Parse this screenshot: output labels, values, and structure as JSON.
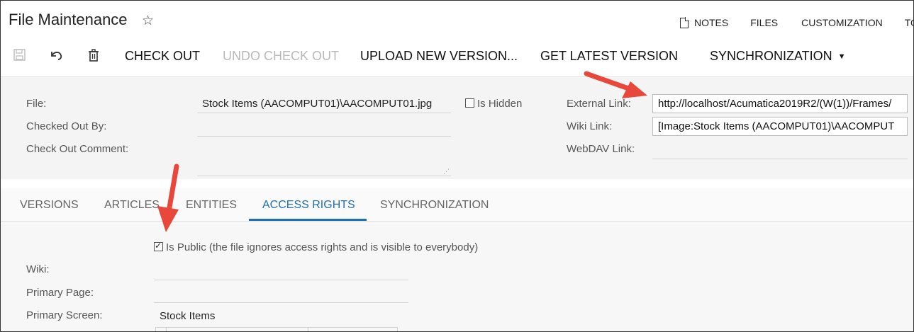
{
  "header": {
    "title": "File Maintenance",
    "nav": [
      {
        "label": "NOTES"
      },
      {
        "label": "FILES"
      },
      {
        "label": "CUSTOMIZATION"
      },
      {
        "label": "TO"
      }
    ]
  },
  "toolbar": {
    "save_icon": "save-icon",
    "undo_icon": "undo-icon",
    "delete_icon": "trash-icon",
    "check_out": "CHECK OUT",
    "undo_check_out": "UNDO CHECK OUT",
    "upload_new_version": "UPLOAD NEW VERSION...",
    "get_latest_version": "GET LATEST VERSION",
    "synchronization": "SYNCHRONIZATION"
  },
  "form": {
    "file_label": "File:",
    "file_value": "Stock Items (AACOMPUT01)\\AACOMPUT01.jpg",
    "is_hidden_label": "Is Hidden",
    "is_hidden_checked": false,
    "checked_out_by_label": "Checked Out By:",
    "checked_out_by_value": "",
    "check_out_comment_label": "Check Out Comment:",
    "check_out_comment_value": "",
    "external_link_label": "External Link:",
    "external_link_value": "http://localhost/Acumatica2019R2/(W(1))/Frames/",
    "wiki_link_label": "Wiki Link:",
    "wiki_link_value": "[Image:Stock Items (AACOMPUT01)\\AACOMPUT",
    "webdav_link_label": "WebDAV Link:",
    "webdav_link_value": ""
  },
  "tabs": [
    {
      "label": "VERSIONS",
      "active": false
    },
    {
      "label": "ARTICLES",
      "active": false
    },
    {
      "label": "ENTITIES",
      "active": false
    },
    {
      "label": "ACCESS RIGHTS",
      "active": true
    },
    {
      "label": "SYNCHRONIZATION",
      "active": false
    }
  ],
  "access_rights": {
    "is_public_label": "Is Public (the file ignores access rights and is visible to everybody)",
    "is_public_checked": true,
    "wiki_label": "Wiki:",
    "wiki_value": "",
    "primary_page_label": "Primary Page:",
    "primary_page_value": "",
    "primary_screen_label": "Primary Screen:",
    "primary_screen_value": "Stock Items"
  },
  "colors": {
    "accent": "#1f6fb2",
    "annotation_arrow": "#e8473c",
    "disabled_text": "#b9b9b9"
  }
}
